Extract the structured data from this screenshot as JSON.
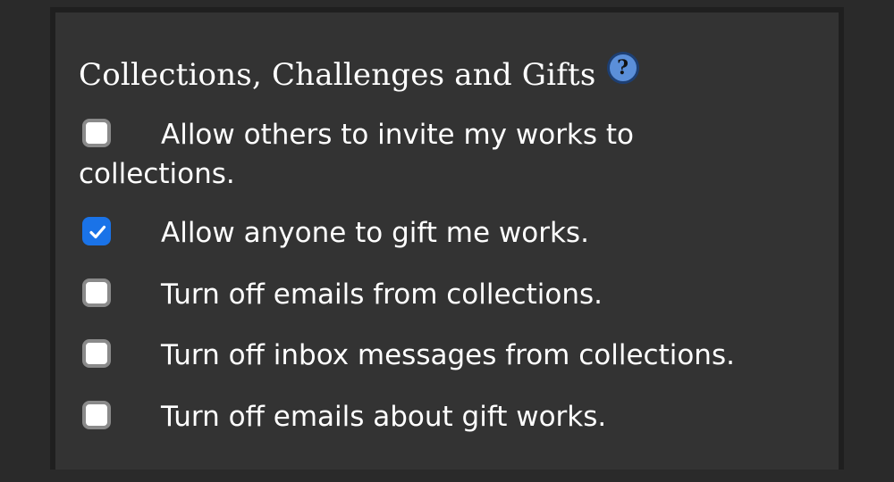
{
  "section": {
    "title": "Collections, Challenges and Gifts",
    "help_icon_text": "?"
  },
  "options": [
    {
      "label": "Allow others to invite my works to collections.",
      "checked": false
    },
    {
      "label": "Allow anyone to gift me works.",
      "checked": true
    },
    {
      "label": "Turn off emails from collections.",
      "checked": false
    },
    {
      "label": "Turn off inbox messages from collections.",
      "checked": false
    },
    {
      "label": "Turn off emails about gift works.",
      "checked": false
    }
  ],
  "colors": {
    "background": "#2a2a2a",
    "panel": "#333333",
    "checkbox_checked": "#1a73e8",
    "help_icon": "#5b8fd9"
  }
}
